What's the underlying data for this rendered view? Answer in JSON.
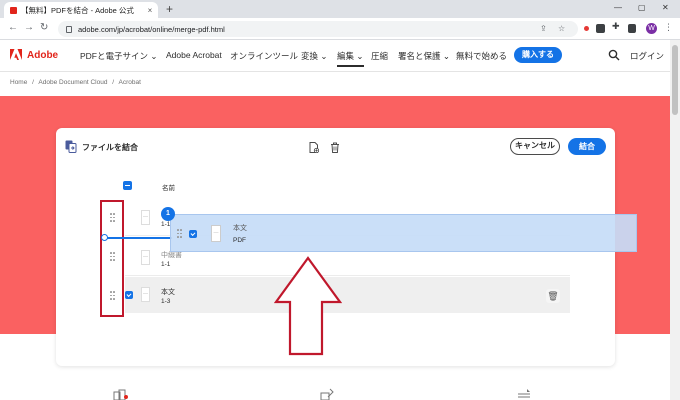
{
  "browser": {
    "tab_title": "【無料】PDFを結合 - Adobe 公式",
    "tab_close": "×",
    "new_tab": "+",
    "url": "adobe.com/jp/acrobat/online/merge-pdf.html",
    "avatar_letter": "W",
    "ext_colors": [
      "#e53935",
      "#3c4043",
      "#3c4043",
      "#3c4043"
    ]
  },
  "nav": {
    "brand": "Adobe",
    "items": [
      "PDFと電子サイン",
      "Adobe Acrobat",
      "オンラインツール",
      "変換",
      "編集",
      "圧縮",
      "署名と保護",
      "無料で始める"
    ],
    "buy": "購入する",
    "login": "ログイン"
  },
  "breadcrumb": [
    "Home",
    "/",
    "Adobe Document Cloud",
    "/",
    "Acrobat"
  ],
  "card": {
    "title": "ファイルを結合",
    "cancel": "キャンセル",
    "combine": "結合",
    "column_name": "名前",
    "rows": [
      {
        "name": "",
        "sub": "1-1"
      },
      {
        "name": "中綴書",
        "sub": "1-1"
      },
      {
        "name": "本文",
        "sub": "1-3"
      }
    ],
    "drag": {
      "badge": "1",
      "name": "本文",
      "sub": "PDF"
    }
  },
  "colors": {
    "hero": "#fa6161",
    "accent": "#1473e6",
    "adobe_red": "#e1251b",
    "annotation": "#c0182c"
  }
}
